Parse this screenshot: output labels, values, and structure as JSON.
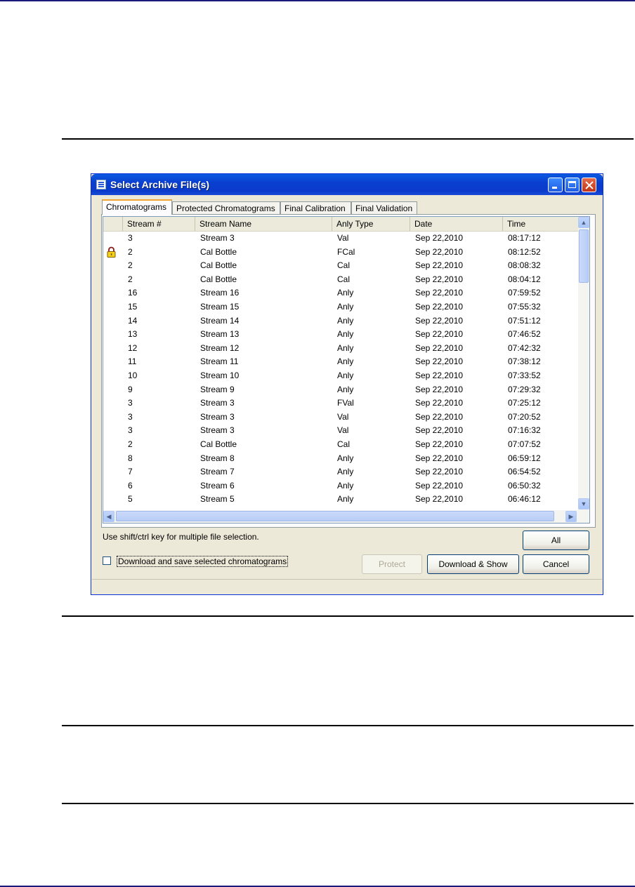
{
  "dialog": {
    "title": "Select Archive File(s)",
    "tabs": [
      "Chromatograms",
      "Protected Chromatograms",
      "Final Calibration",
      "Final Validation"
    ],
    "active_tab": "Chromatograms",
    "columns": [
      "Stream #",
      "Stream Name",
      "Anly Type",
      "Date",
      "Time"
    ],
    "rows": [
      {
        "locked": false,
        "stream": "3",
        "name": "Stream 3",
        "type": "Val",
        "date": "Sep 22,2010",
        "time": "08:17:12"
      },
      {
        "locked": true,
        "stream": "2",
        "name": "Cal Bottle",
        "type": "FCal",
        "date": "Sep 22,2010",
        "time": "08:12:52"
      },
      {
        "locked": false,
        "stream": "2",
        "name": "Cal Bottle",
        "type": "Cal",
        "date": "Sep 22,2010",
        "time": "08:08:32"
      },
      {
        "locked": false,
        "stream": "2",
        "name": "Cal Bottle",
        "type": "Cal",
        "date": "Sep 22,2010",
        "time": "08:04:12"
      },
      {
        "locked": false,
        "stream": "16",
        "name": "Stream 16",
        "type": "Anly",
        "date": "Sep 22,2010",
        "time": "07:59:52"
      },
      {
        "locked": false,
        "stream": "15",
        "name": "Stream 15",
        "type": "Anly",
        "date": "Sep 22,2010",
        "time": "07:55:32"
      },
      {
        "locked": false,
        "stream": "14",
        "name": "Stream 14",
        "type": "Anly",
        "date": "Sep 22,2010",
        "time": "07:51:12"
      },
      {
        "locked": false,
        "stream": "13",
        "name": "Stream 13",
        "type": "Anly",
        "date": "Sep 22,2010",
        "time": "07:46:52"
      },
      {
        "locked": false,
        "stream": "12",
        "name": "Stream 12",
        "type": "Anly",
        "date": "Sep 22,2010",
        "time": "07:42:32"
      },
      {
        "locked": false,
        "stream": "11",
        "name": "Stream 11",
        "type": "Anly",
        "date": "Sep 22,2010",
        "time": "07:38:12"
      },
      {
        "locked": false,
        "stream": "10",
        "name": "Stream 10",
        "type": "Anly",
        "date": "Sep 22,2010",
        "time": "07:33:52"
      },
      {
        "locked": false,
        "stream": "9",
        "name": "Stream 9",
        "type": "Anly",
        "date": "Sep 22,2010",
        "time": "07:29:32"
      },
      {
        "locked": false,
        "stream": "3",
        "name": "Stream 3",
        "type": "FVal",
        "date": "Sep 22,2010",
        "time": "07:25:12"
      },
      {
        "locked": false,
        "stream": "3",
        "name": "Stream 3",
        "type": "Val",
        "date": "Sep 22,2010",
        "time": "07:20:52"
      },
      {
        "locked": false,
        "stream": "3",
        "name": "Stream 3",
        "type": "Val",
        "date": "Sep 22,2010",
        "time": "07:16:32"
      },
      {
        "locked": false,
        "stream": "2",
        "name": "Cal Bottle",
        "type": "Cal",
        "date": "Sep 22,2010",
        "time": "07:07:52"
      },
      {
        "locked": false,
        "stream": "8",
        "name": "Stream 8",
        "type": "Anly",
        "date": "Sep 22,2010",
        "time": "06:59:12"
      },
      {
        "locked": false,
        "stream": "7",
        "name": "Stream 7",
        "type": "Anly",
        "date": "Sep 22,2010",
        "time": "06:54:52"
      },
      {
        "locked": false,
        "stream": "6",
        "name": "Stream 6",
        "type": "Anly",
        "date": "Sep 22,2010",
        "time": "06:50:32"
      },
      {
        "locked": false,
        "stream": "5",
        "name": "Stream 5",
        "type": "Anly",
        "date": "Sep 22,2010",
        "time": "06:46:12"
      }
    ],
    "hint": "Use shift/ctrl key for multiple file selection.",
    "checkbox_label": "Download and save selected chromatograms",
    "checkbox_checked": false,
    "buttons": {
      "all": "All",
      "protect": "Protect",
      "download_show": "Download & Show",
      "cancel": "Cancel"
    },
    "protect_enabled": false
  }
}
